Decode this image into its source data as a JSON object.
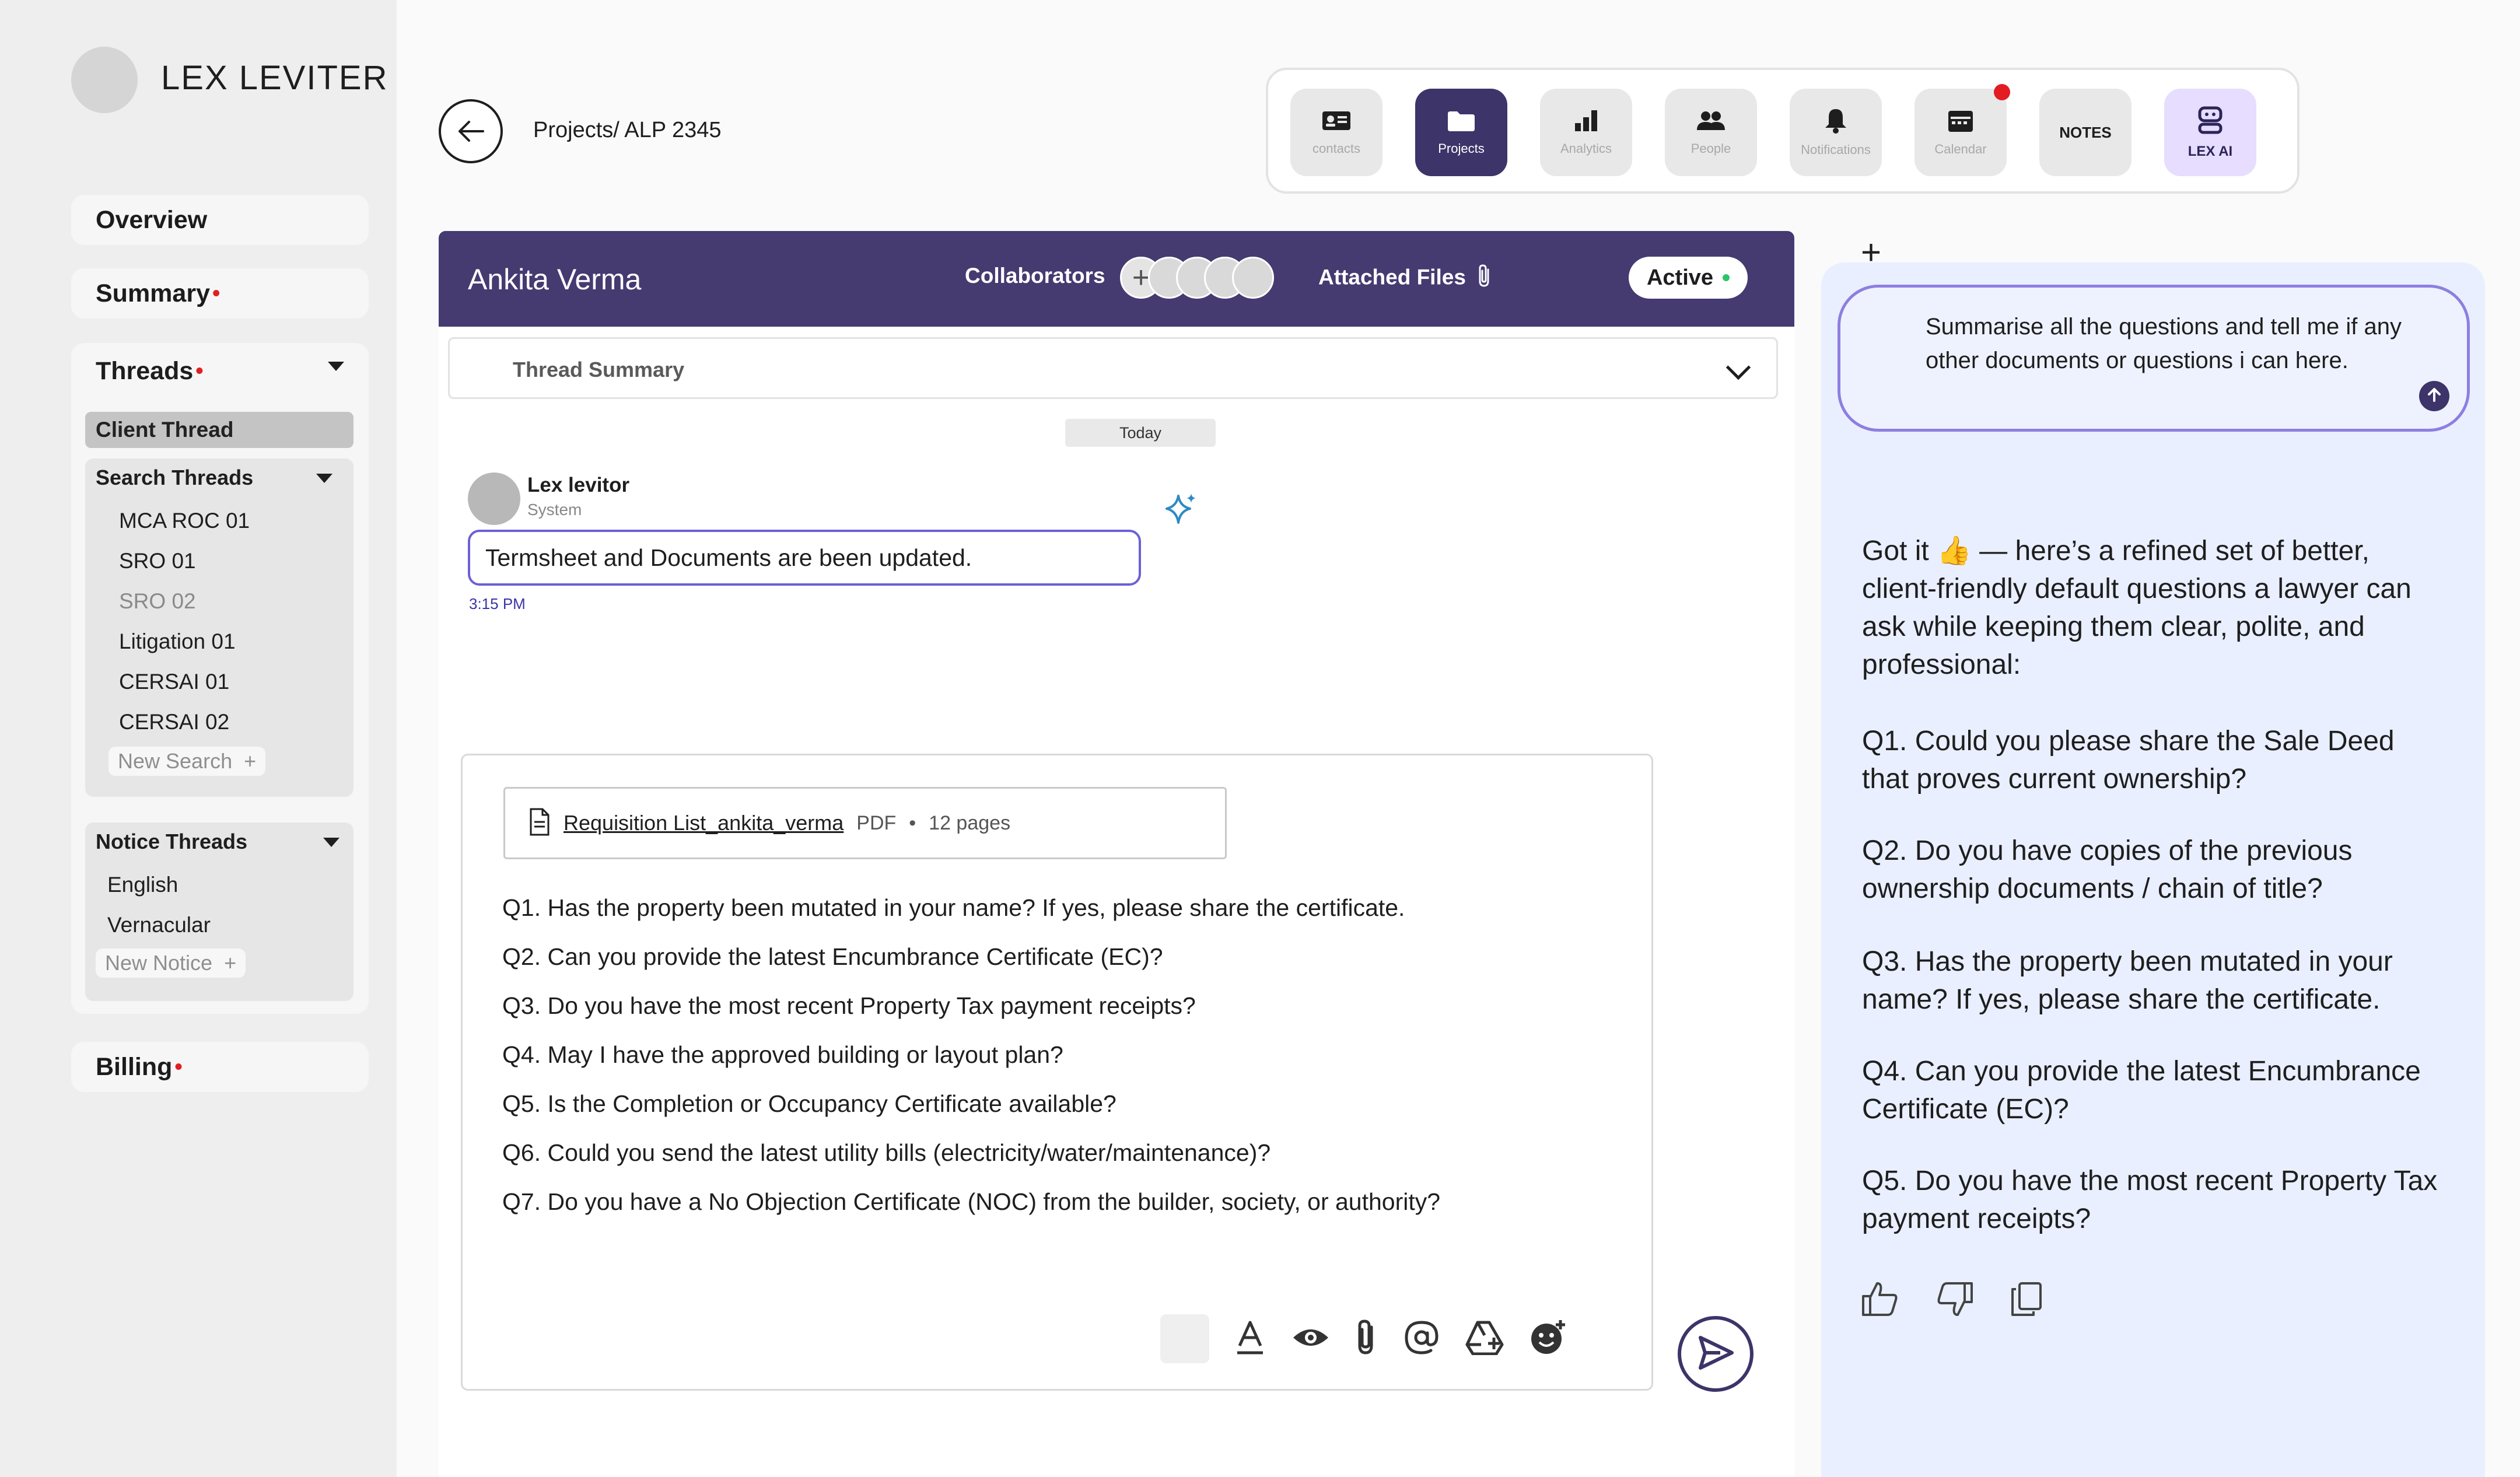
{
  "brand": {
    "name": "LEX LEVITER"
  },
  "sidebar": {
    "overview": "Overview",
    "summary": "Summary",
    "threads": "Threads",
    "client_thread": "Client Thread",
    "search_threads": {
      "title": "Search Threads",
      "items": [
        "MCA ROC 01",
        "SRO 01",
        "SRO 02",
        "Litigation 01",
        "CERSAI 01",
        "CERSAI 02"
      ],
      "new_label": "New Search"
    },
    "notice_threads": {
      "title": "Notice Threads",
      "items": [
        "English",
        "Vernacular"
      ],
      "new_label": "New Notice"
    },
    "billing": "Billing",
    "alert_dot": "•"
  },
  "header": {
    "breadcrumb": "Projects/ ALP 2345",
    "tools": [
      {
        "label": "contacts",
        "icon": "contacts-icon"
      },
      {
        "label": "Projects",
        "icon": "folder-icon"
      },
      {
        "label": "Analytics",
        "icon": "bar-chart-icon"
      },
      {
        "label": "People",
        "icon": "people-icon"
      },
      {
        "label": "Notifications",
        "icon": "bell-icon"
      },
      {
        "label": "Calendar",
        "icon": "calendar-icon"
      },
      {
        "label": "NOTES",
        "icon": ""
      },
      {
        "label": "LEX AI",
        "icon": "robot-icon"
      }
    ]
  },
  "thread": {
    "client_name": "Ankita Verma",
    "collaborators_label": "Collaborators",
    "attached_files_label": "Attached Files",
    "status": "Active",
    "summary_label": "Thread Summary",
    "date_divider": "Today"
  },
  "message": {
    "sender": "Lex levitor",
    "role": "System",
    "text": "Termsheet and Documents are been updated.",
    "time": "3:15 PM"
  },
  "compose": {
    "attachment": {
      "name": "Requisition List_ankita_verma",
      "type": "PDF",
      "pages": "12 pages"
    },
    "questions": [
      "Q1. Has the property been mutated in your name? If yes, please share the certificate.",
      "Q2. Can you provide the latest Encumbrance Certificate (EC)?",
      "Q3. Do you have the most recent Property Tax payment receipts?",
      "Q4. May I have the approved building or layout plan?",
      "Q5. Is the Completion or Occupancy Certificate available?",
      "Q6. Could you send the latest utility bills (electricity/water/maintenance)?",
      "Q7. Do you have a No Objection Certificate (NOC) from the builder, society, or authority?"
    ],
    "format_icons": [
      "text-format-icon",
      "eye-icon",
      "paperclip-icon",
      "mention-icon",
      "drive-icon",
      "emoji-icon"
    ]
  },
  "ai": {
    "prompt": "Summarise all the questions and tell me if any other documents or questions i can here.",
    "response_intro": "Got it 👍 — here’s a refined set of better, client-friendly default questions a lawyer can ask while keeping them clear, polite, and professional:",
    "response_items": [
      "Q1. Could you please share the Sale Deed that proves current ownership?",
      "Q2. Do you have copies of the previous ownership documents / chain of title?",
      "Q3. Has the property been mutated in your name? If yes, please share the certificate.",
      "Q4. Can you provide the latest Encumbrance Certificate (EC)?",
      "Q5. Do you have the most recent Property Tax payment receipts?"
    ]
  },
  "colors": {
    "primary": "#453b71",
    "accent": "#6d5fd6",
    "alert": "#e31b23",
    "ai_bg": "#e9efff"
  }
}
